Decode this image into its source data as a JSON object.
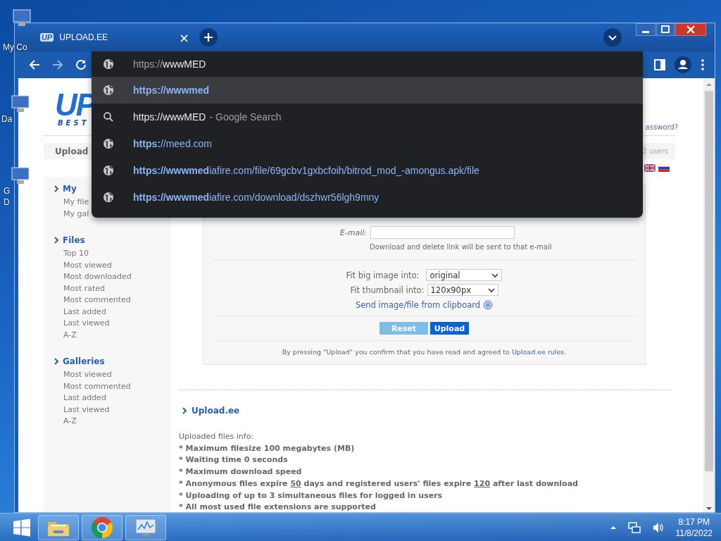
{
  "desktop": {
    "icons": [
      {
        "label": "My Co"
      },
      {
        "label": "Da"
      },
      {
        "label": "G"
      },
      {
        "label": "D"
      }
    ]
  },
  "browser": {
    "tab": {
      "favicon": "UP",
      "title": "UPLOAD.EE",
      "close": "×"
    },
    "omnibox": {
      "scheme_part": "https://",
      "typed_part": "wwwMED"
    },
    "suggestions": [
      {
        "kind": "url",
        "text": "**https://wwwmed**",
        "selected": true
      },
      {
        "kind": "search",
        "text": "https://wwwMED",
        "description": "- Google Search",
        "selected": false
      },
      {
        "kind": "url",
        "text": "**https:**//meed.com",
        "selected": false
      },
      {
        "kind": "url",
        "text": "**https://wwwmed**iafire.com/file/69gcbv1gxbcfoih/bitrod_mod_-amongus.apk/file",
        "selected": false
      },
      {
        "kind": "url",
        "text": "**https://wwwmed**iafire.com/download/dszhwr56lgh9mny",
        "selected": false
      }
    ]
  },
  "page": {
    "logo": {
      "text": "UP",
      "tagline": "BEST"
    },
    "forgot_link": "assword?",
    "nav": {
      "tab": "Upload",
      "users": "2 users"
    },
    "flags": [
      {
        "kind": "uk"
      },
      {
        "kind": "ru"
      }
    ],
    "sidebar": [
      {
        "title": "My",
        "items": [
          "My file",
          "My gal"
        ]
      },
      {
        "title": "Files",
        "items": [
          "Top 10",
          "Most viewed",
          "Most downloaded",
          "Most rated",
          "Most commented",
          "Last added",
          "Last viewed",
          "A-Z"
        ]
      },
      {
        "title": "Galleries",
        "items": [
          "Most viewed",
          "Most commented",
          "Last added",
          "Last viewed",
          "A-Z"
        ]
      }
    ],
    "form": {
      "email_label": "E-mail:",
      "email_hint": "Download and delete link will be sent to that e-mail",
      "selects": [
        {
          "label": "Fit big image into:",
          "value": "original"
        },
        {
          "label": "Fit thumbnail into:",
          "value": "120x90px"
        }
      ],
      "clipboard_link": "Send image/file from clipboard",
      "buttons": [
        {
          "label": "Reset",
          "kind": "secondary"
        },
        {
          "label": "Upload",
          "kind": "primary"
        }
      ],
      "agreement": "By pressing \"Upload\" you confirm that you have read and agreed to",
      "rules_link": "Upload.ee rules."
    },
    "info": {
      "title": "Upload.ee",
      "intro": "Uploaded files info:",
      "lines": [
        [
          {
            "text": "* Maximum filesize 100 megabytes (MB)",
            "underline": false
          }
        ],
        [
          {
            "text": "* Waiting time 0 seconds",
            "underline": false
          }
        ],
        [
          {
            "text": "* Maximum download speed",
            "underline": false
          }
        ],
        [
          {
            "text": "* Anonymous files expire ",
            "underline": false
          },
          {
            "text": "50",
            "underline": true
          },
          {
            "text": " days and registered users' files expire ",
            "underline": false
          },
          {
            "text": "120",
            "underline": true
          },
          {
            "text": " after last download",
            "underline": false
          }
        ],
        [
          {
            "text": "* Uploading of up to 3 simultaneous files for logged in users",
            "underline": false
          }
        ],
        [
          {
            "text": "* All most used file extensions are supported",
            "underline": false
          }
        ]
      ]
    }
  },
  "taskbar": {
    "apps": [
      {
        "kind": "folder"
      },
      {
        "kind": "chrome"
      },
      {
        "kind": "monitor"
      }
    ],
    "time": "8:17 PM",
    "date": "11/8/2022"
  }
}
